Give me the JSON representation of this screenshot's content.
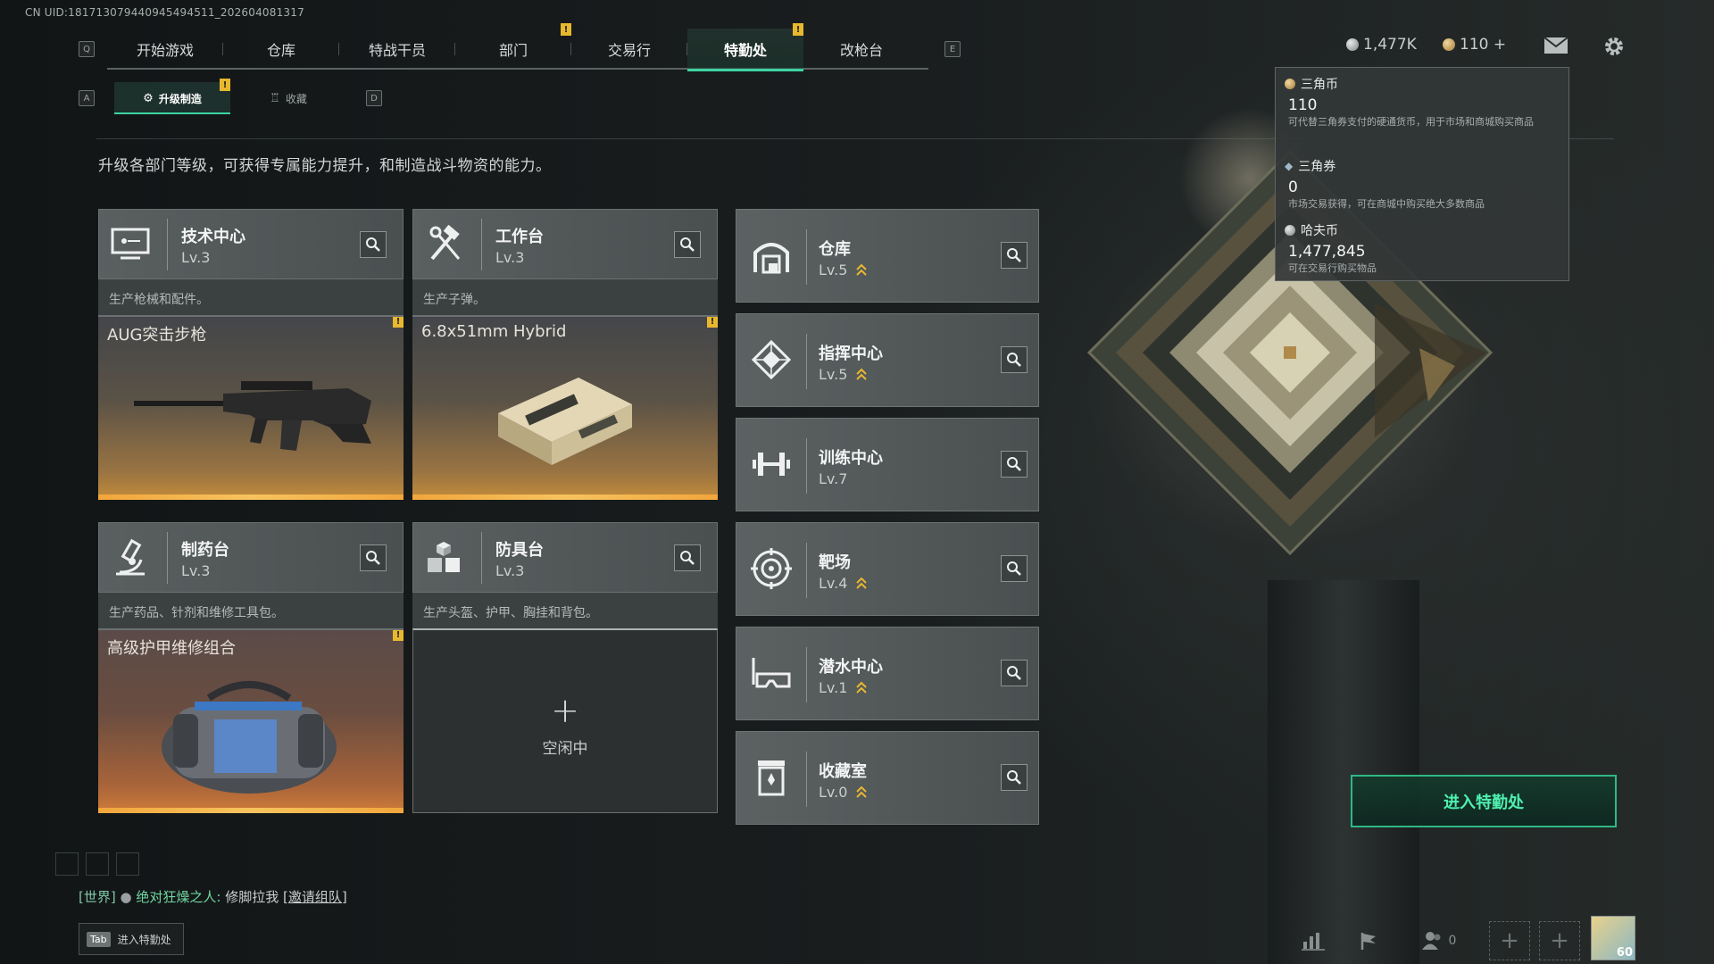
{
  "uid": "CN UID:181713079440945494511_202604081317",
  "nav": {
    "left_key": "Q",
    "right_key": "E",
    "tabs": [
      {
        "label": "开始游戏"
      },
      {
        "label": "仓库"
      },
      {
        "label": "特战干员"
      },
      {
        "label": "部门",
        "badge": "!"
      },
      {
        "label": "交易行"
      },
      {
        "label": "特勤处",
        "badge": "!",
        "active": true
      },
      {
        "label": "改枪台"
      }
    ]
  },
  "currency": {
    "havcoin": "1,477K",
    "triangle": "110 +"
  },
  "subnav": {
    "left_key": "A",
    "right_key": "D",
    "tabs": [
      {
        "label": "升级制造",
        "badge": "!",
        "active": true
      },
      {
        "label": "收藏"
      }
    ]
  },
  "description": "升级各部门等级，可获得专属能力提升，和制造战斗物资的能力。",
  "workshops": [
    {
      "name": "技术中心",
      "level": "Lv.3",
      "subtitle": "生产枪械和配件。",
      "product": "AUG突击步枪",
      "badge": "!",
      "icon": "computer-icon"
    },
    {
      "name": "工作台",
      "level": "Lv.3",
      "subtitle": "生产子弹。",
      "product": "6.8x51mm Hybrid",
      "badge": "!",
      "icon": "tools-icon"
    },
    {
      "name": "制药台",
      "level": "Lv.3",
      "subtitle": "生产药品、针剂和维修工具包。",
      "product": "高级护甲维修组合",
      "badge": "!",
      "icon": "microscope-icon"
    },
    {
      "name": "防具台",
      "level": "Lv.3",
      "subtitle": "生产头盔、护甲、胸挂和背包。",
      "idle_label": "空闲中",
      "icon": "boxes-icon"
    }
  ],
  "departments": [
    {
      "name": "仓库",
      "level": "Lv.5",
      "upgradable": true,
      "icon": "warehouse-icon"
    },
    {
      "name": "指挥中心",
      "level": "Lv.5",
      "upgradable": true,
      "icon": "command-icon"
    },
    {
      "name": "训练中心",
      "level": "Lv.7",
      "upgradable": false,
      "icon": "dumbbell-icon"
    },
    {
      "name": "靶场",
      "level": "Lv.4",
      "upgradable": true,
      "icon": "target-icon"
    },
    {
      "name": "潜水中心",
      "level": "Lv.1",
      "upgradable": true,
      "icon": "goggles-icon"
    },
    {
      "name": "收藏室",
      "level": "Lv.0",
      "upgradable": true,
      "icon": "collection-icon"
    }
  ],
  "tooltip": {
    "items": [
      {
        "title": "三角币",
        "value": "110",
        "desc": "可代替三角券支付的硬通货币，用于市场和商城购买商品"
      },
      {
        "title": "三角券",
        "value": "0",
        "desc": "市场交易获得，可在商城中购买绝大多数商品"
      },
      {
        "title": "哈夫币",
        "value": "1,477,845",
        "desc": "可在交易行购买物品"
      }
    ]
  },
  "enter_button": "进入特勤处",
  "chat": {
    "channel": "[世界]",
    "sender": "绝对狂燥之人:",
    "message": "修脚拉我",
    "invite": "[邀请组队]"
  },
  "tab_hint": {
    "key": "Tab",
    "label": "进入特勤处"
  },
  "bottom": {
    "friends_count": "0",
    "level": "60"
  },
  "colors": {
    "accent": "#3cd4a0",
    "badge": "#e8b82e",
    "progress": "#f7c35e"
  }
}
